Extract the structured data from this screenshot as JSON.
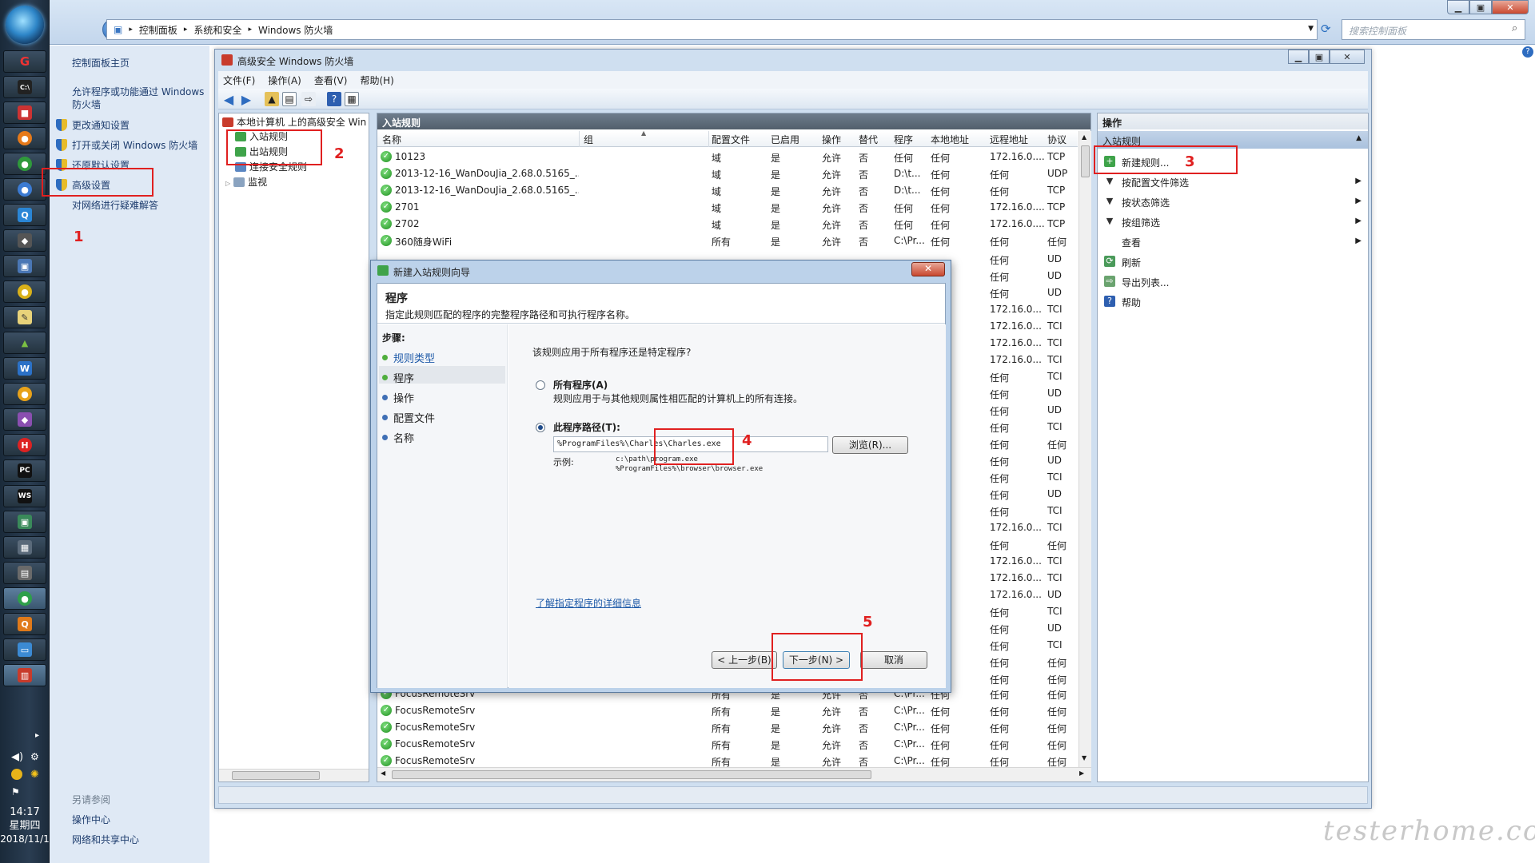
{
  "explorer": {
    "breadcrumb": [
      "控制面板",
      "系统和安全",
      "Windows 防火墙"
    ],
    "search_placeholder": "搜索控制面板"
  },
  "taskbar": {
    "time": "14:17",
    "weekday": "星期四",
    "date": "2018/11/1"
  },
  "left_pane": {
    "links": [
      "控制面板主页",
      "允许程序或功能通过 Windows",
      "防火墙",
      "更改通知设置",
      "打开或关闭 Windows 防火墙",
      "还原默认设置",
      "高级设置",
      "对网络进行疑难解答"
    ],
    "see_also_title": "另请参阅",
    "see_also": [
      "操作中心",
      "网络和共享中心"
    ]
  },
  "mmc": {
    "title": "高级安全 Windows 防火墙",
    "menu": [
      "文件(F)",
      "操作(A)",
      "查看(V)",
      "帮助(H)"
    ],
    "tree": [
      "本地计算机 上的高级安全 Win",
      "入站规则",
      "出站规则",
      "连接安全规则",
      "监视"
    ],
    "center_title": "入站规则",
    "columns": [
      "名称",
      "组",
      "配置文件",
      "已启用",
      "操作",
      "替代",
      "程序",
      "本地地址",
      "远程地址",
      "协议"
    ],
    "rows": [
      [
        "10123",
        "",
        "域",
        "是",
        "允许",
        "否",
        "任何",
        "任何",
        "172.16.0....",
        "TCP"
      ],
      [
        "2013-12-16_WanDouJia_2.68.0.5165_...",
        "",
        "域",
        "是",
        "允许",
        "否",
        "D:\\t...",
        "任何",
        "任何",
        "UDP"
      ],
      [
        "2013-12-16_WanDouJia_2.68.0.5165_...",
        "",
        "域",
        "是",
        "允许",
        "否",
        "D:\\t...",
        "任何",
        "任何",
        "TCP"
      ],
      [
        "2701",
        "",
        "域",
        "是",
        "允许",
        "否",
        "任何",
        "任何",
        "172.16.0....",
        "TCP"
      ],
      [
        "2702",
        "",
        "域",
        "是",
        "允许",
        "否",
        "任何",
        "任何",
        "172.16.0....",
        "TCP"
      ],
      [
        "360随身WiFi",
        "",
        "所有",
        "是",
        "允许",
        "否",
        "C:\\Pr...",
        "任何",
        "任何",
        "任何"
      ]
    ],
    "behind_rows": [
      [
        "任何",
        "UD"
      ],
      [
        "任何",
        "UD"
      ],
      [
        "任何",
        "UD"
      ],
      [
        "172.16.0...",
        "TCI"
      ],
      [
        "172.16.0...",
        "TCI"
      ],
      [
        "172.16.0...",
        "TCI"
      ],
      [
        "172.16.0...",
        "TCI"
      ],
      [
        "任何",
        "TCI"
      ],
      [
        "任何",
        "UD"
      ],
      [
        "任何",
        "UD"
      ],
      [
        "任何",
        "TCI"
      ],
      [
        "任何",
        "任何"
      ],
      [
        "任何",
        "UD"
      ],
      [
        "任何",
        "TCI"
      ],
      [
        "任何",
        "UD"
      ],
      [
        "任何",
        "TCI"
      ],
      [
        "172.16.0...",
        "TCI"
      ],
      [
        "任何",
        "任何"
      ],
      [
        "172.16.0...",
        "TCI"
      ],
      [
        "172.16.0...",
        "TCI"
      ],
      [
        "172.16.0...",
        "UD"
      ],
      [
        "任何",
        "TCI"
      ],
      [
        "任何",
        "UD"
      ],
      [
        "任何",
        "TCI"
      ],
      [
        "任何",
        "任何"
      ],
      [
        "任何",
        "任何"
      ]
    ],
    "bottom_rows": [
      [
        "FocusRemoteSrv",
        "",
        "所有",
        "是",
        "允许",
        "否",
        "C:\\Pr...",
        "任何",
        "任何",
        "任何"
      ],
      [
        "FocusRemoteSrv",
        "",
        "所有",
        "是",
        "允许",
        "否",
        "C:\\Pr...",
        "任何",
        "任何",
        "任何"
      ],
      [
        "FocusRemoteSrv",
        "",
        "所有",
        "是",
        "允许",
        "否",
        "C:\\Pr...",
        "任何",
        "任何",
        "任何"
      ],
      [
        "FocusRemoteSrv",
        "",
        "所有",
        "是",
        "允许",
        "否",
        "C:\\Pr...",
        "任何",
        "任何",
        "任何"
      ],
      [
        "FocusRemoteSrv",
        "",
        "所有",
        "是",
        "允许",
        "否",
        "C:\\Pr...",
        "任何",
        "任何",
        "任何"
      ]
    ],
    "actions_title": "操作",
    "actions_section": "入站规则",
    "actions": [
      "新建规则...",
      "按配置文件筛选",
      "按状态筛选",
      "按组筛选",
      "查看",
      "刷新",
      "导出列表...",
      "帮助"
    ]
  },
  "wizard": {
    "title": "新建入站规则向导",
    "heading": "程序",
    "description": "指定此规则匹配的程序的完整程序路径和可执行程序名称。",
    "steps_title": "步骤:",
    "steps": [
      "规则类型",
      "程序",
      "操作",
      "配置文件",
      "名称"
    ],
    "question": "该规则应用于所有程序还是特定程序?",
    "all_programs_label": "所有程序(A)",
    "all_programs_desc": "规则应用于与其他规则属性相匹配的计算机上的所有连接。",
    "this_program_label": "此程序路径(T):",
    "program_path": "%ProgramFiles%\\Charles\\Charles.exe",
    "browse_label": "浏览(R)...",
    "example_label": "示例:",
    "example_1": "c:\\path\\program.exe",
    "example_2": "%ProgramFiles%\\browser\\browser.exe",
    "learn_more": "了解指定程序的详细信息",
    "back_label": "< 上一步(B)",
    "next_label": "下一步(N) >",
    "cancel_label": "取消"
  },
  "annotations": [
    "1",
    "2",
    "3",
    "4",
    "5"
  ],
  "watermark": "testerhome.com",
  "colors": {
    "annotation_red": "#e02020",
    "link_blue": "#1e3d6e",
    "check_green": "#1f8f1f"
  }
}
